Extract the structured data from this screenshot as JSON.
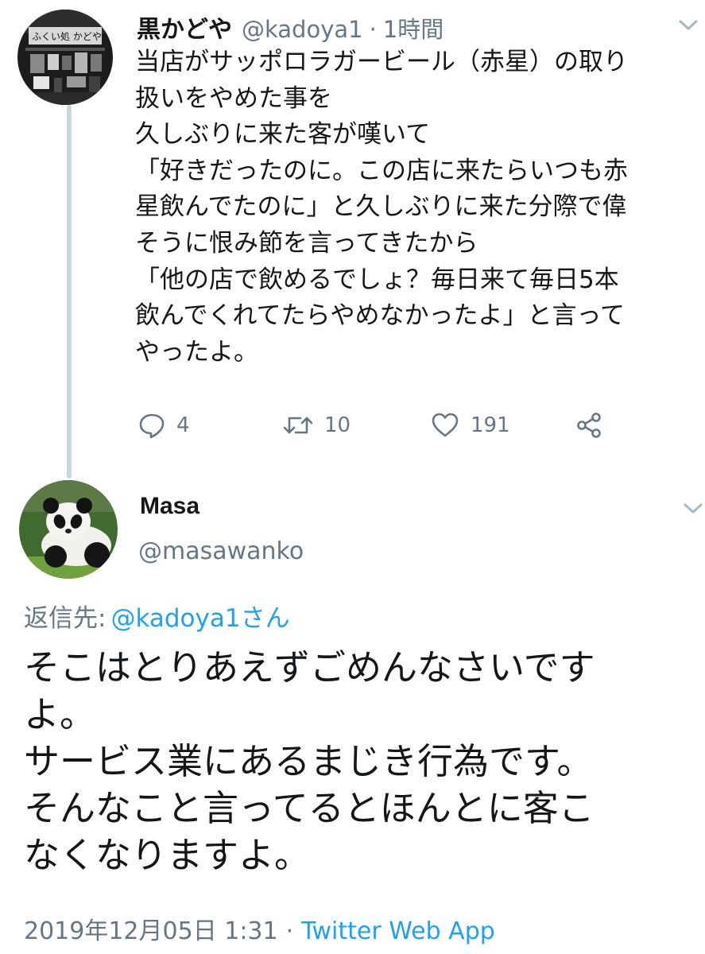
{
  "tweet": {
    "display_name": "黒かどや",
    "handle": "@kadoya1",
    "separator": "·",
    "time": "1時間",
    "text": "当店がサッポロラガービール（赤星）の取り\n扱いをやめた事を\n久しぶりに来た客が嘆いて\n「好きだったのに。この店に来たらいつも赤\n星飲んでたのに」と久しぶりに来た分際で偉\nそうに恨み節を言ってきたから\n「他の店で飲めるでしょ？毎日来て毎日5本\n飲んでくれてたらやめなかったよ」と言って\nやったよ。",
    "actions": {
      "reply_icon": "reply-icon",
      "reply_count": "4",
      "retweet_icon": "retweet-icon",
      "retweet_count": "10",
      "like_icon": "heart-icon",
      "like_count": "191",
      "share_icon": "share-icon"
    }
  },
  "reply": {
    "display_name": "Masa",
    "handle": "@masawanko",
    "replying_label": "返信先:",
    "replying_user": "@kadoya1さん",
    "text": "そこはとりあえずごめんなさいです\nよ。\nサービス業にあるまじき行為です。\nそんなこと言ってるとほんとに客こ\nなくなりますよ。",
    "timestamp": "2019年12月05日 1:31",
    "separator": "·",
    "source": "Twitter Web App"
  },
  "colors": {
    "text": "#14171a",
    "secondary": "#657786",
    "link": "#1da1f2",
    "thread_line": "#ccd6dd"
  }
}
